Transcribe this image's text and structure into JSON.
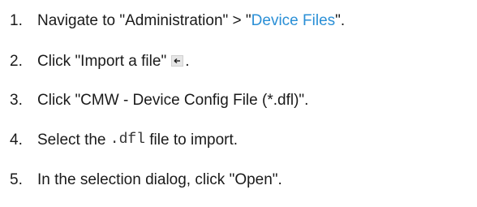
{
  "steps": [
    {
      "number": "1.",
      "text_before": "Navigate to \"Administration\" > \"",
      "link": "Device Files",
      "text_after": "\"."
    },
    {
      "number": "2.",
      "text_before": "Click \"Import a file\"",
      "icon": "import-file-icon",
      "text_after": "."
    },
    {
      "number": "3.",
      "text": "Click \"CMW - Device Config File (*.dfl)\"."
    },
    {
      "number": "4.",
      "text_before": "Select the ",
      "code": ".dfl",
      "text_after": " file to import."
    },
    {
      "number": "5.",
      "text": "In the selection dialog, click \"Open\"."
    }
  ],
  "colors": {
    "link": "#2a8fd6",
    "text": "#1a1a1a",
    "icon_bg": "#e6e6e6"
  }
}
